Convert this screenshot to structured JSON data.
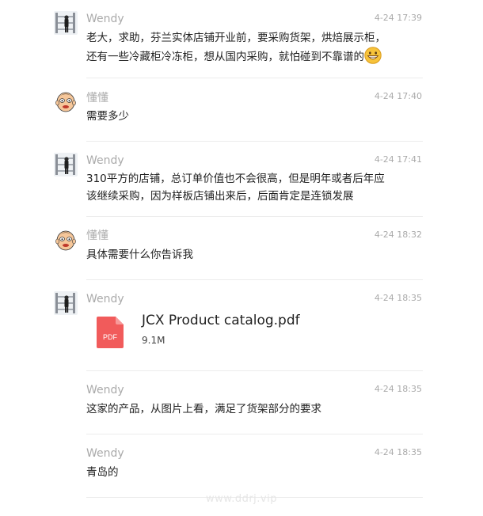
{
  "messages": [
    {
      "sender": "Wendy",
      "time": "4-24 17:39",
      "avatar": "wendy-avatar",
      "line1": "老大，求助，芬兰实体店铺开业前，要采购货架，烘焙展示柜，",
      "line2": "还有一些冷藏柜冷冻柜，想从国内采购，就怕碰到不靠谱的",
      "emoji": "grinning-face-emoji"
    },
    {
      "sender": "懂懂",
      "time": "4-24 17:40",
      "avatar": "dongdong-avatar",
      "line1": "需要多少"
    },
    {
      "sender": "Wendy",
      "time": "4-24 17:41",
      "avatar": "wendy-avatar",
      "line1": "310平方的店铺，总订单价值也不会很高，但是明年或者后年应",
      "line2": "该继续采购，因为样板店铺出来后，后面肯定是连锁发展"
    },
    {
      "sender": "懂懂",
      "time": "4-24 18:32",
      "avatar": "dongdong-avatar",
      "line1": "具体需要什么你告诉我"
    },
    {
      "sender": "Wendy",
      "time": "4-24 18:35",
      "avatar": "wendy-avatar",
      "file": {
        "name": "JCX Product catalog.pdf",
        "size": "9.1M",
        "icon_label": "PDF",
        "icon": "pdf-file-icon",
        "icon_color": "#f15b5b"
      }
    },
    {
      "sender": "Wendy",
      "time": "4-24 18:35",
      "line1": "这家的产品，从图片上看，满足了货架部分的要求"
    },
    {
      "sender": "Wendy",
      "time": "4-24 18:35",
      "line1": "青岛的"
    }
  ],
  "watermark": "www.ddrj.vip",
  "colors": {
    "name": "#aaaaaa",
    "time": "#aaaaaa",
    "text": "#222222",
    "divider": "#ececec",
    "pdf": "#f15b5b"
  }
}
